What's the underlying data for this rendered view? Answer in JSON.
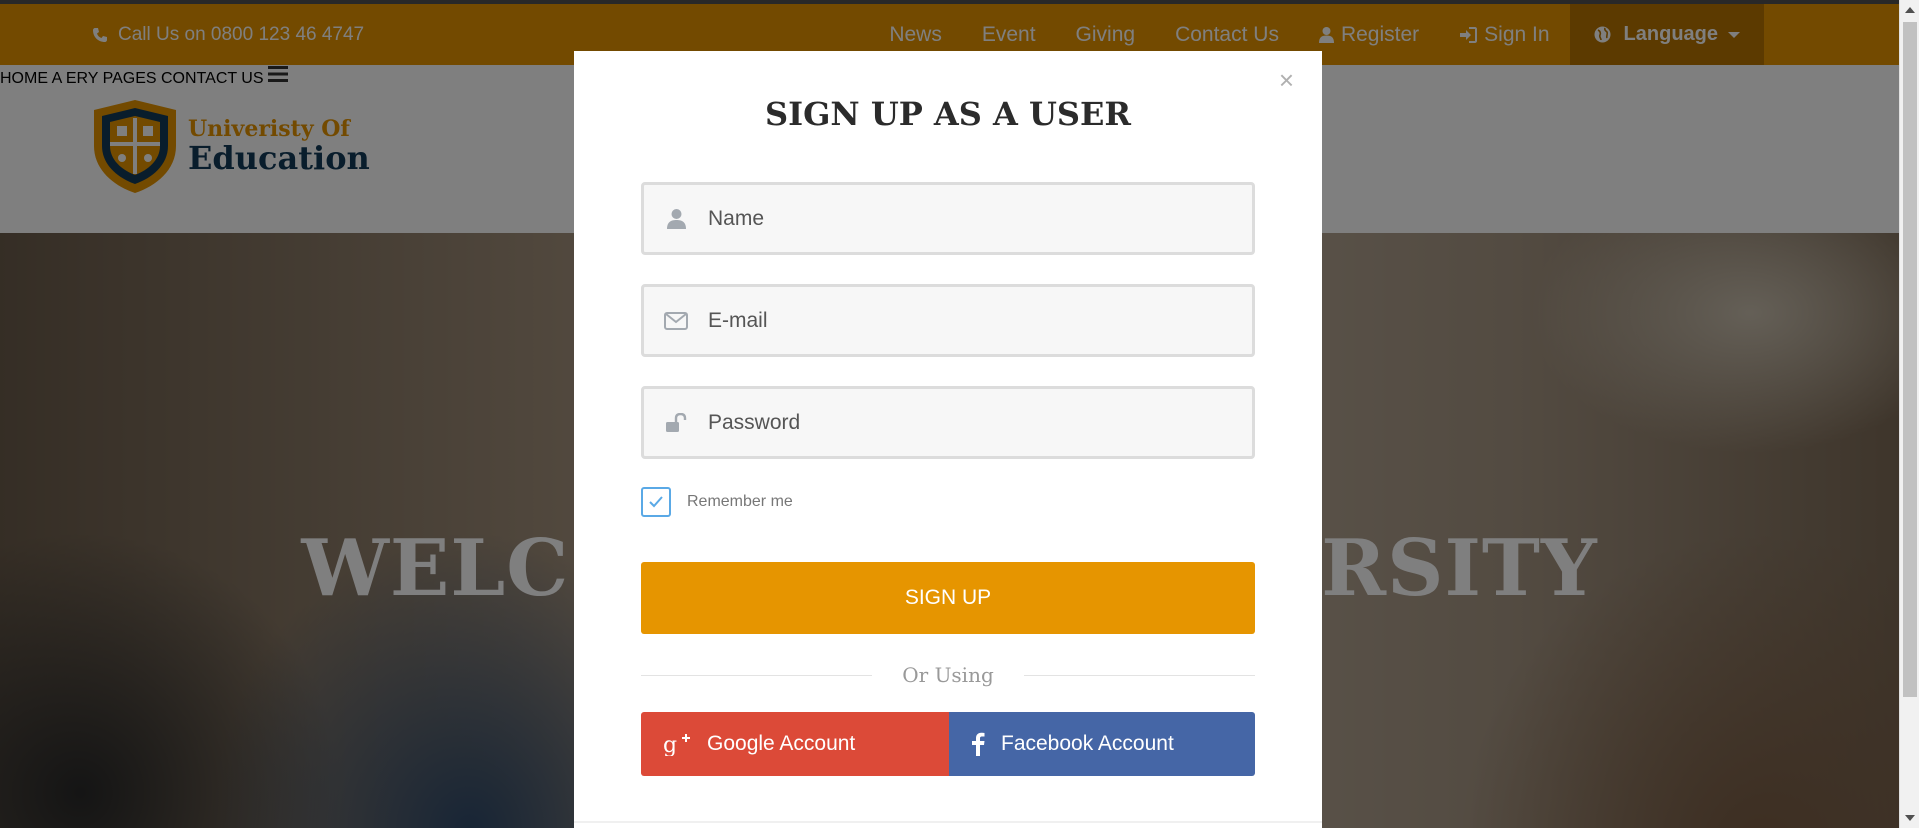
{
  "topbar": {
    "phone_text": "Call Us on 0800 123 46 4747",
    "links": [
      {
        "label": "News"
      },
      {
        "label": "Event"
      },
      {
        "label": "Giving"
      },
      {
        "label": "Contact Us"
      },
      {
        "label": "Register",
        "icon": "user-icon"
      },
      {
        "label": "Sign In",
        "icon": "sign-in-icon"
      }
    ],
    "language_label": "Language",
    "color": "#e69500"
  },
  "logo": {
    "line1": "Univeristy Of",
    "line2": "Education"
  },
  "nav": {
    "items": [
      "HOME",
      "A",
      "ERY",
      "PAGES",
      "CONTACT US"
    ],
    "menu_icon": "hamburger-icon"
  },
  "hero": {
    "title_left": "WELC",
    "title_right": "RSITY"
  },
  "modal": {
    "title": "SIGN UP AS A USER",
    "close_symbol": "×",
    "name_placeholder": "Name",
    "email_placeholder": "E-mail",
    "password_placeholder": "Password",
    "remember_label": "Remember me",
    "remember_checked": true,
    "signup_label": "SIGN UP",
    "or_text": "Or Using",
    "google_label": "Google Account",
    "facebook_label": "Facebook Account",
    "google_color": "#dc4a38",
    "facebook_color": "#4566a6"
  }
}
